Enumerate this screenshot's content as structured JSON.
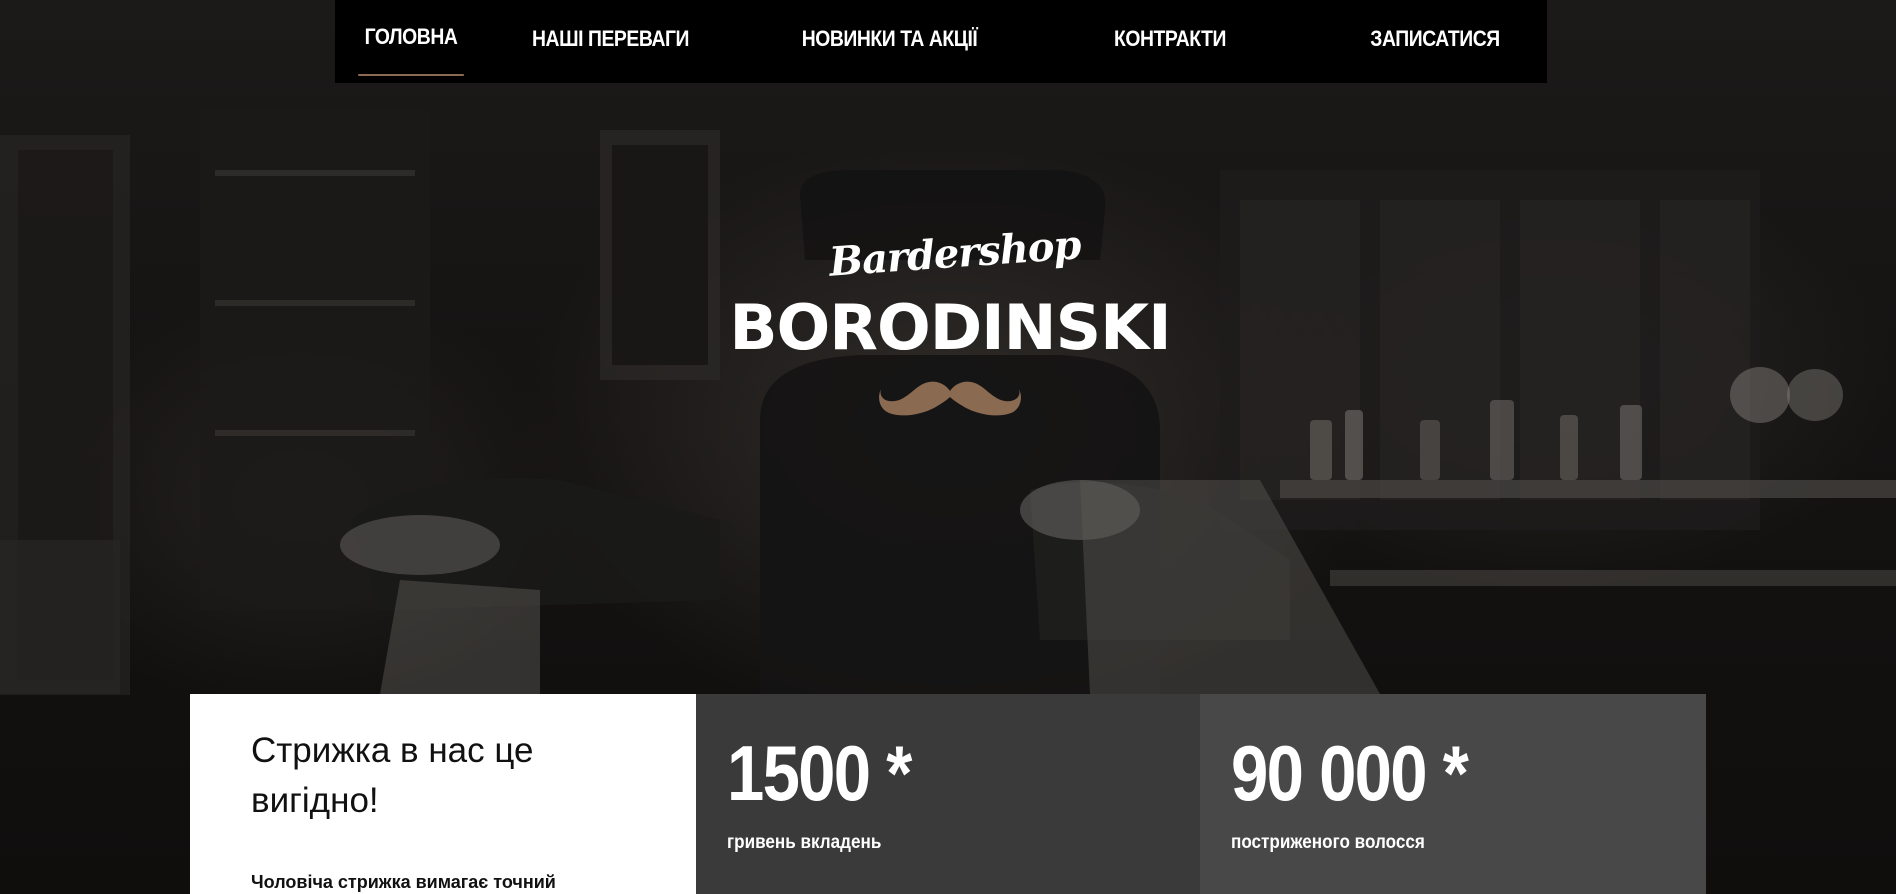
{
  "nav": {
    "items": [
      {
        "label": "ГОЛОВНА",
        "active": true
      },
      {
        "label": "НАШІ ПЕРЕВАГИ",
        "active": false
      },
      {
        "label": "НОВИНКИ ТА АКЦІЇ",
        "active": false
      },
      {
        "label": "КОНТРАКТИ",
        "active": false
      },
      {
        "label": "ЗАПИСАТИСЯ",
        "active": false
      }
    ]
  },
  "logo": {
    "script": "Bardershop",
    "main": "BORODINSKI",
    "icon": "mustache-icon"
  },
  "intro": {
    "heading": "Стрижка в нас це вигідно!",
    "body": "Чоловіча стрижка вимагає точний"
  },
  "stats": [
    {
      "value": "1500 *",
      "label": "гривень вкладень"
    },
    {
      "value": "90 000 *",
      "label": "постриженого волосся"
    }
  ],
  "colors": {
    "accent": "#8b6a52",
    "nav_bg": "#000000",
    "panel_white": "#ffffff",
    "panel_dark_1": "#3a3a3a",
    "panel_dark_2": "#484848"
  }
}
